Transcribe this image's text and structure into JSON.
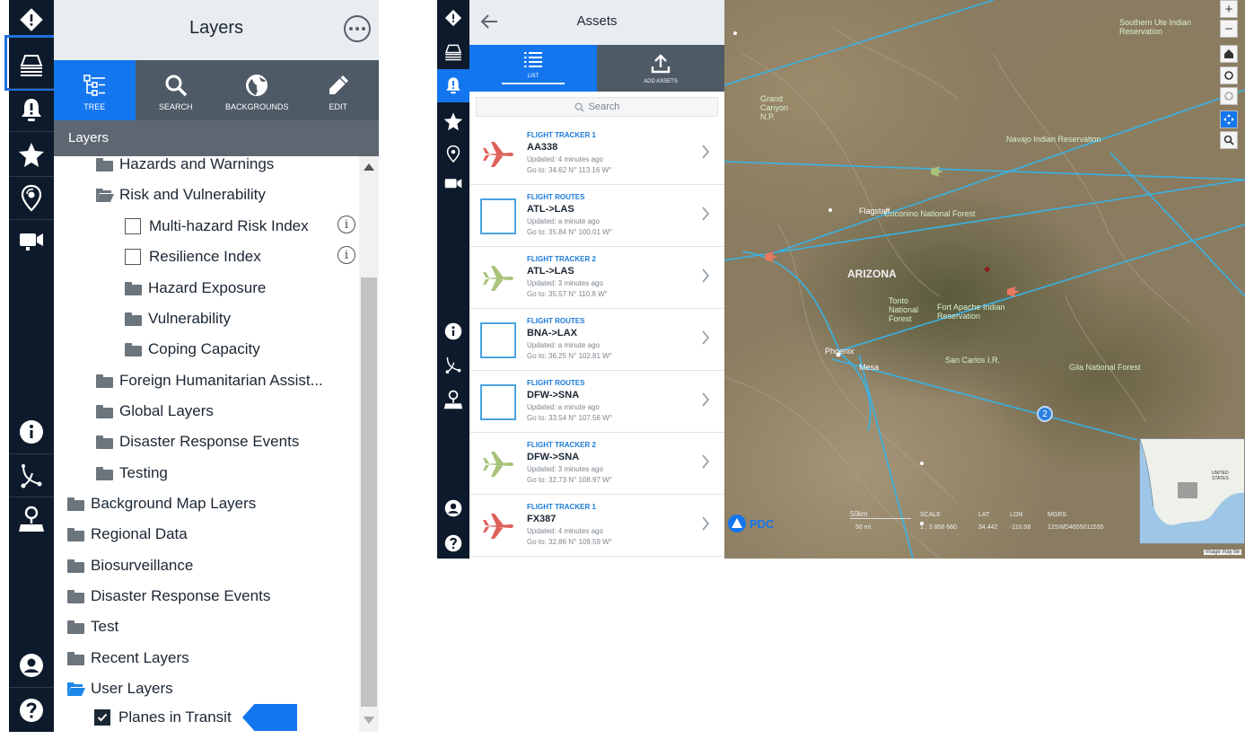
{
  "layers_panel": {
    "title": "Layers",
    "tabs": [
      {
        "label": "TREE",
        "icon": "tree-icon",
        "active": true
      },
      {
        "label": "SEARCH",
        "icon": "search-icon",
        "active": false
      },
      {
        "label": "BACKGROUNDS",
        "icon": "globe-icon",
        "active": false
      },
      {
        "label": "EDIT",
        "icon": "pencil-icon",
        "active": false
      }
    ],
    "section_title": "Layers",
    "tree": [
      {
        "label": "Hazards and Warnings",
        "type": "folder"
      },
      {
        "label": "Risk and Vulnerability",
        "type": "folder-open"
      },
      {
        "label": "Multi-hazard Risk Index",
        "type": "checkbox",
        "checked": false,
        "info": true
      },
      {
        "label": "Resilience Index",
        "type": "checkbox",
        "checked": false,
        "info": true
      },
      {
        "label": "Hazard Exposure",
        "type": "folder"
      },
      {
        "label": "Vulnerability",
        "type": "folder"
      },
      {
        "label": "Coping Capacity",
        "type": "folder"
      },
      {
        "label": "Foreign Humanitarian Assist...",
        "type": "folder"
      },
      {
        "label": "Global Layers",
        "type": "folder"
      },
      {
        "label": "Disaster Response Events",
        "type": "folder"
      },
      {
        "label": "Testing",
        "type": "folder"
      },
      {
        "label": "Background Map Layers",
        "type": "folder"
      },
      {
        "label": "Regional Data",
        "type": "folder"
      },
      {
        "label": "Biosurveillance",
        "type": "folder"
      },
      {
        "label": "Disaster Response Events",
        "type": "folder"
      },
      {
        "label": "Test",
        "type": "folder"
      },
      {
        "label": "Recent Layers",
        "type": "folder"
      },
      {
        "label": "User Layers",
        "type": "folder-open"
      },
      {
        "label": "Planes in Transit",
        "type": "checkbox",
        "checked": true,
        "info": false
      }
    ]
  },
  "left_rail": {
    "icons": [
      "alert-diamond-icon",
      "layers-icon",
      "bell-icon",
      "star-icon",
      "location-pin-icon",
      "video-icon",
      "info-icon",
      "route-icon",
      "map-marker-icon",
      "user-icon",
      "help-icon"
    ]
  },
  "assets_panel": {
    "title": "Assets",
    "tabs": [
      {
        "label": "LIST",
        "icon": "list-icon",
        "active": true
      },
      {
        "label": "ADD ASSETS",
        "icon": "upload-icon",
        "active": false
      }
    ],
    "search_placeholder": "Search",
    "items": [
      {
        "category": "FLIGHT TRACKER 1",
        "name": "AA338",
        "updated": "Updated: 4 minutes ago",
        "goto": "Go to: 34.62 N° 113.16 W°",
        "thumb": "plane",
        "color": "#e0605a"
      },
      {
        "category": "FLIGHT ROUTES",
        "name": "ATL->LAS",
        "updated": "Updated: a minute ago",
        "goto": "Go to: 35.84 N° 100.01 W°",
        "thumb": "route",
        "color": "#4aa3e0"
      },
      {
        "category": "FLIGHT TRACKER 2",
        "name": "ATL->LAS",
        "updated": "Updated: 3 minutes ago",
        "goto": "Go to: 35.57 N° 110.8 W°",
        "thumb": "plane",
        "color": "#a9c27a"
      },
      {
        "category": "FLIGHT ROUTES",
        "name": "BNA->LAX",
        "updated": "Updated: a minute ago",
        "goto": "Go to: 36.25 N° 102.81 W°",
        "thumb": "route",
        "color": "#4aa3e0"
      },
      {
        "category": "FLIGHT ROUTES",
        "name": "DFW->SNA",
        "updated": "Updated: a minute ago",
        "goto": "Go to: 33.54 N° 107.56 W°",
        "thumb": "route",
        "color": "#4aa3e0"
      },
      {
        "category": "FLIGHT TRACKER 2",
        "name": "DFW->SNA",
        "updated": "Updated: 3 minutes ago",
        "goto": "Go to: 32.73 N° 108.97 W°",
        "thumb": "plane",
        "color": "#a9c27a"
      },
      {
        "category": "FLIGHT TRACKER 1",
        "name": "FX387",
        "updated": "Updated: 4 minutes ago",
        "goto": "Go to: 32.86 N° 109.59 W°",
        "thumb": "plane",
        "color": "#e0605a"
      }
    ]
  },
  "map": {
    "labels": {
      "state": "ARIZONA",
      "forest1": "Coconino National Forest",
      "forest2": "Tonto National Forest",
      "reservation": "Fort Apache Indian Reservation",
      "gila": "Gila National Forest",
      "san_carlos": "San Carlos I.R.",
      "grand_canyon": "Grand Canyon N.P.",
      "flagstaff": "Flagstaff",
      "navajo": "Navajo Indian Reservation",
      "southern_ute": "Southern Ute Indian Reservation",
      "mesa": "Mesa",
      "phoenix": "Phoenix",
      "cluster_count": "2",
      "logo": "PDC",
      "minimap_label": "UNITED STATES",
      "disclaimer": "Image may be"
    },
    "scale": {
      "label": "SCALE",
      "value": "1 : 3 856 660"
    },
    "scalebar": {
      "label": "50km",
      "sub": "50 mi"
    },
    "lat": {
      "label": "LAT",
      "value": "34.442"
    },
    "lon": {
      "label": "LON",
      "value": "-110.08"
    },
    "mgrs": {
      "label": "MGRS",
      "value": "12SWD4655011535"
    }
  },
  "colors": {
    "rail": "#0d1a2b",
    "accent": "#1476ee",
    "tab_bar": "#4e5a66",
    "route_line": "#37b3e6"
  }
}
